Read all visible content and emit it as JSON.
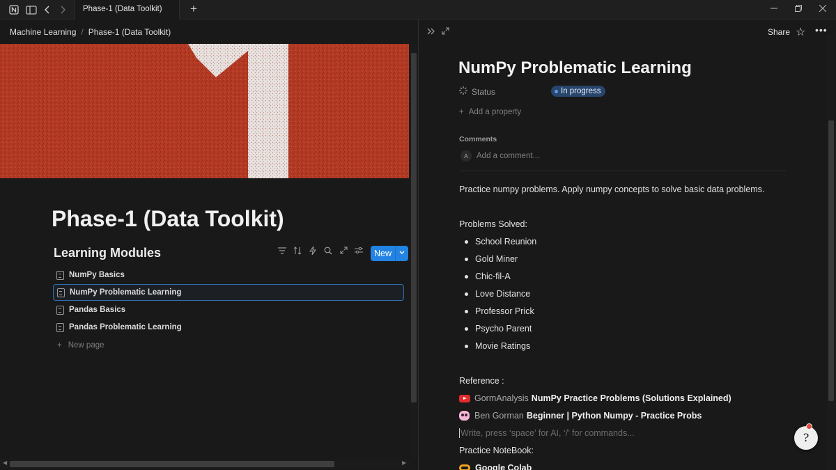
{
  "titlebar": {
    "tab_title": "Phase-1 (Data Toolkit)",
    "new_tab_glyph": "+",
    "icons": [
      "notion-logo-icon",
      "sidebar-toggle-icon",
      "back-arrow-icon",
      "forward-arrow-icon"
    ]
  },
  "left": {
    "breadcrumb": [
      "Machine Learning",
      "Phase-1 (Data Toolkit)"
    ],
    "breadcrumb_sep": "/",
    "page_title": "Phase-1 (Data Toolkit)",
    "database": {
      "title": "Learning Modules",
      "new_label": "New",
      "rows": [
        "NumPy Basics",
        "NumPy Problematic Learning",
        "Pandas Basics",
        "Pandas Problematic Learning"
      ],
      "new_page": "New page"
    }
  },
  "right": {
    "share_label": "Share",
    "title": "NumPy Problematic Learning",
    "status_label": "Status",
    "status_value": "In progress",
    "add_property": "Add a property",
    "comments_label": "Comments",
    "avatar_letter": "A",
    "add_comment": "Add a comment...",
    "description": "Practice numpy problems. Apply numpy concepts to solve basic data problems.",
    "problems_heading": "Problems Solved:",
    "problems": [
      "School Reunion",
      "Gold Miner",
      "Chic-fil-A",
      "Love Distance",
      "Professor Prick",
      "Psycho Parent",
      "Movie Ratings"
    ],
    "reference_heading": "Reference :",
    "references": [
      {
        "source": "GormAnalysis",
        "link": "NumPy Practice Problems (Solutions Explained)",
        "icon": "youtube-icon"
      },
      {
        "source": "Ben Gorman",
        "link": "Beginner | Python Numpy - Practice Probs",
        "icon": "owl-icon"
      }
    ],
    "editor_placeholder": "Write, press ‘space’ for AI, ‘/’ for commands...",
    "notebook_heading": "Practice NoteBook:",
    "notebook_link": "Google Colab",
    "help_glyph": "?"
  },
  "colors": {
    "accent": "#2383e2",
    "status_pill": "#28456c",
    "cover_red": "#b03521",
    "background": "#191919"
  }
}
